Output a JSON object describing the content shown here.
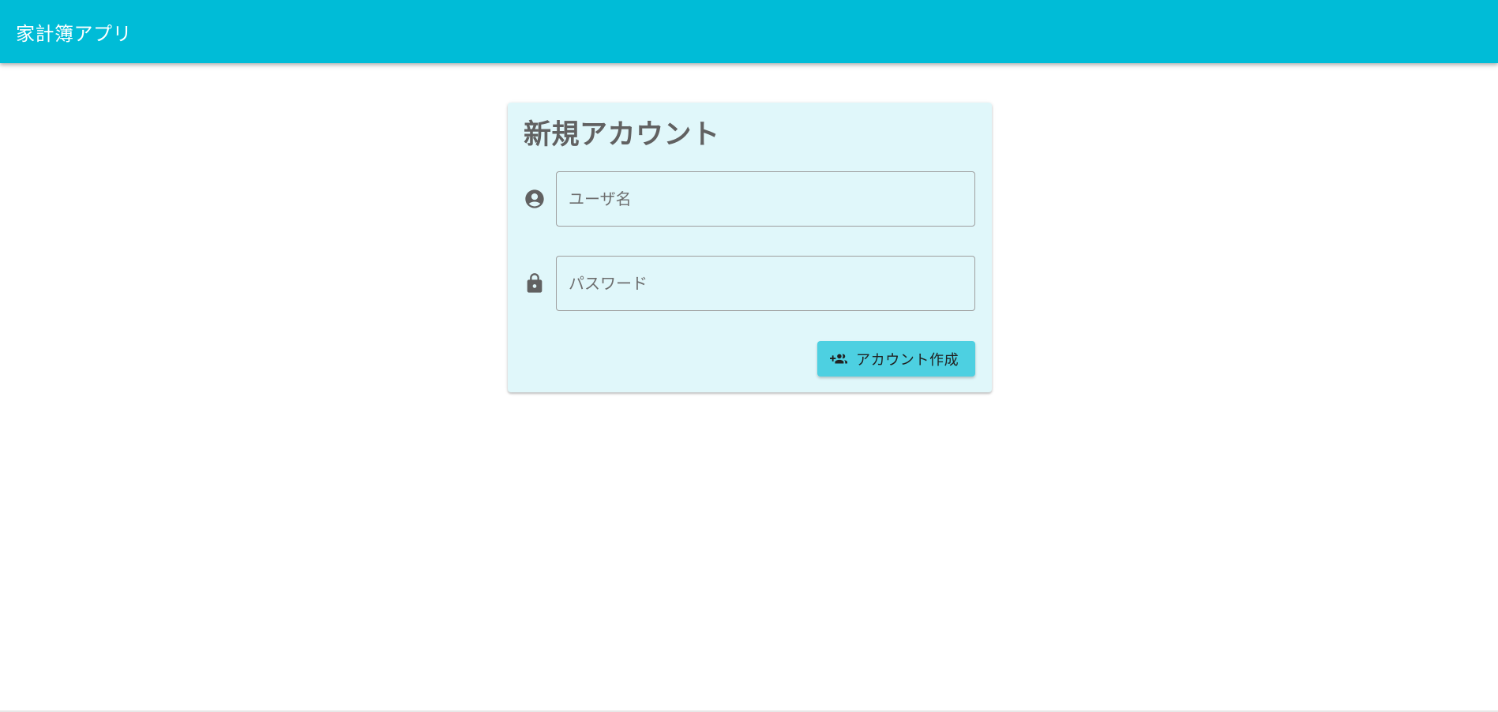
{
  "app_bar": {
    "title": "家計簿アプリ",
    "color": "#00bcd7"
  },
  "signup_card": {
    "title": "新規アカウント",
    "background": "#e0f7fa",
    "username": {
      "icon": "account-circle-icon",
      "placeholder": "ユーザ名",
      "value": ""
    },
    "password": {
      "icon": "lock-icon",
      "placeholder": "パスワード",
      "value": ""
    },
    "create_button": {
      "icon": "group-add-icon",
      "label": "アカウント作成",
      "color": "#4dd0e1"
    }
  }
}
